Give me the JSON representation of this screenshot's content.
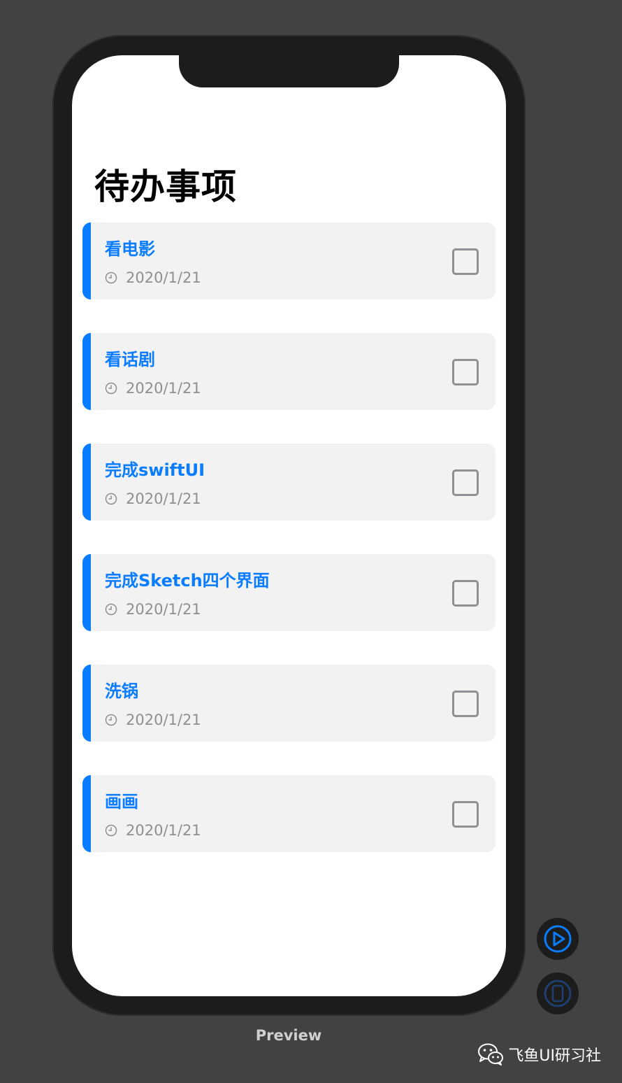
{
  "screen": {
    "nav_title": "待办事项",
    "todos": [
      {
        "title": "看电影",
        "date": "2020/1/21",
        "checked": false
      },
      {
        "title": "看话剧",
        "date": "2020/1/21",
        "checked": false
      },
      {
        "title": "完成swiftUI",
        "date": "2020/1/21",
        "checked": false
      },
      {
        "title": "完成Sketch四个界面",
        "date": "2020/1/21",
        "checked": false
      },
      {
        "title": "洗锅",
        "date": "2020/1/21",
        "checked": false
      },
      {
        "title": "画画",
        "date": "2020/1/21",
        "checked": false
      }
    ]
  },
  "canvas_controls": {
    "play_icon": "play-circle-icon",
    "device_icon": "device-icon"
  },
  "preview_label": "Preview",
  "watermark": {
    "icon": "wechat-icon",
    "text": "飞鱼UI研习社"
  },
  "colors": {
    "accent": "#0a7cff",
    "card_bg": "#f2f2f2",
    "secondary_text": "#8e8e93",
    "canvas_bg": "#424242",
    "device_frame": "#1c1c1c"
  }
}
